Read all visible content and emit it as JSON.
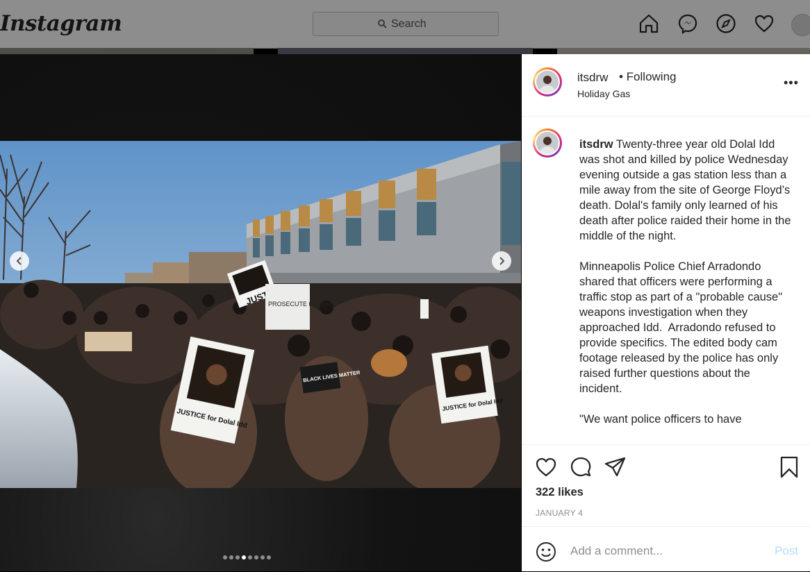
{
  "app": {
    "logo": "Instagram"
  },
  "search": {
    "placeholder": "Search"
  },
  "nav": {
    "icons": [
      "home-icon",
      "messenger-icon",
      "explore-icon",
      "heart-icon",
      "profile-avatar"
    ]
  },
  "post": {
    "username": "itsdrw",
    "following_label": "• Following",
    "location": "Holiday Gas",
    "more_label": "•••",
    "caption_username": "itsdrw",
    "caption_text": " Twenty-three year old Dolal Idd was shot and killed by police Wednesday evening outside a gas station less than a mile away from the site of George Floyd’s death. Dolal's family only learned of his death after police raided their home in the middle of the night.\n\nMinneapolis Police Chief Arradondo shared that officers were performing a traffic stop as part of a \"probable cause\" weapons investigation when they approached Idd.  Arradondo refused to provide specifics. The edited body cam footage released by the police has only raised further questions about the incident.\n\n\"We want police officers to have",
    "likes": "322 likes",
    "date": "JANUARY 4",
    "carousel_count": 8,
    "carousel_active": 3
  },
  "photo_signs": {
    "sign1": "JUSTICE",
    "sign2": "PROSECUTE the police",
    "sign3": "BLACK LIVES MATTER",
    "sign4": "JUSTICE for Dolal Idd",
    "sign5": "JUSTICE for Dolal Idd"
  },
  "comment": {
    "placeholder": "Add a comment...",
    "post_label": "Post"
  },
  "colors": {
    "link_disabled": "#b3dbff",
    "text": "#262626",
    "muted": "#8e8e8e"
  }
}
